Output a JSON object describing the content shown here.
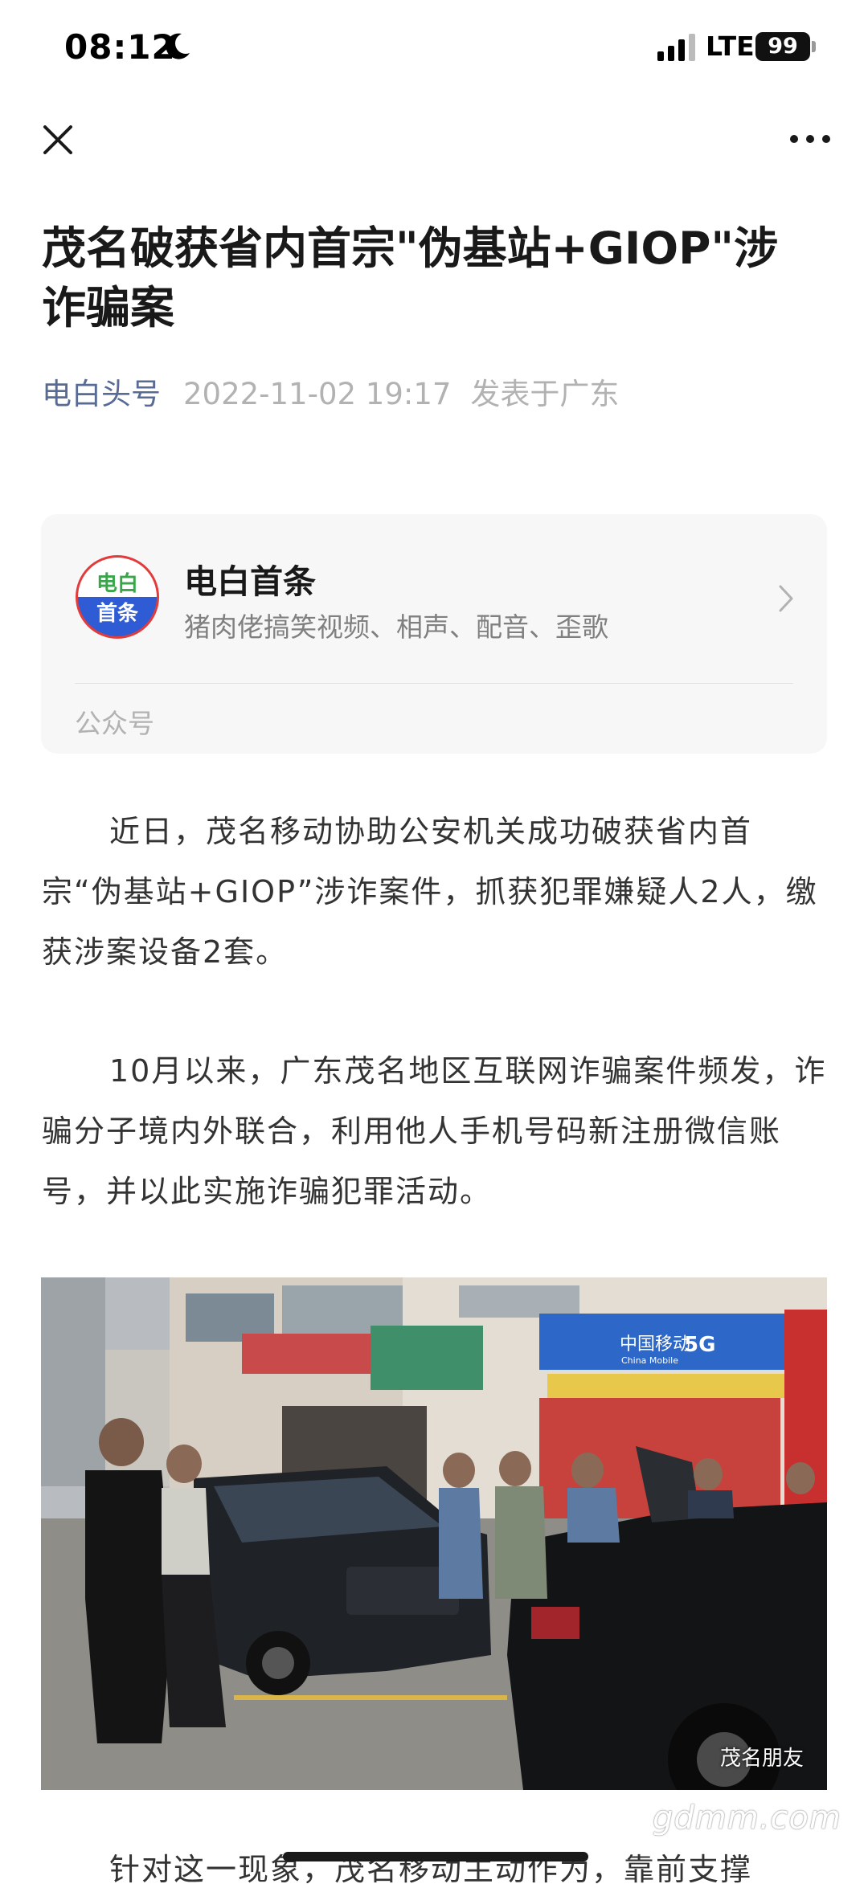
{
  "status_bar": {
    "time": "08:12",
    "network": "LTE",
    "battery": "99",
    "icons": [
      "moon-icon",
      "signal-icon",
      "battery-icon"
    ]
  },
  "nav": {
    "icons": [
      "close-icon",
      "more-icon"
    ]
  },
  "article": {
    "title": "茂名破获省内首宗\"伪基站+GIOP\"涉诈骗案",
    "author": "电白头号",
    "date": "2022-11-02 19:17",
    "location": "发表于广东",
    "paragraphs": [
      "近日，茂名移动协助公安机关成功破获省内首宗“伪基站+GIOP”涉诈案件，抓获犯罪嫌疑人2人，缴获涉案设备2套。",
      "10月以来，广东茂名地区互联网诈骗案件频发，诈骗分子境内外联合，利用他人手机号码新注册微信账号，并以此实施诈骗犯罪活动。",
      "针对这一现象，茂名移动主动作为，靠前支撑"
    ]
  },
  "account_card": {
    "logo_line1": "电白",
    "logo_line2": "首条",
    "name": "电白首条",
    "description": "猪肉佬搞笑视频、相声、配音、歪歌",
    "footer": "公众号",
    "colors": {
      "logo_top": "#3aa64a",
      "logo_bottom": "#2f5bd4",
      "logo_ring": "#e23b3b"
    }
  },
  "photo": {
    "shop_sign": "中国移动",
    "shop_sign_sub": "China Mobile",
    "badge": "5G",
    "watermark": "茂名朋友",
    "site_watermark": "gdmm.com"
  },
  "colors": {
    "author_link": "#576b95",
    "muted": "#b2b2b2",
    "card_bg": "#f7f7f7"
  }
}
